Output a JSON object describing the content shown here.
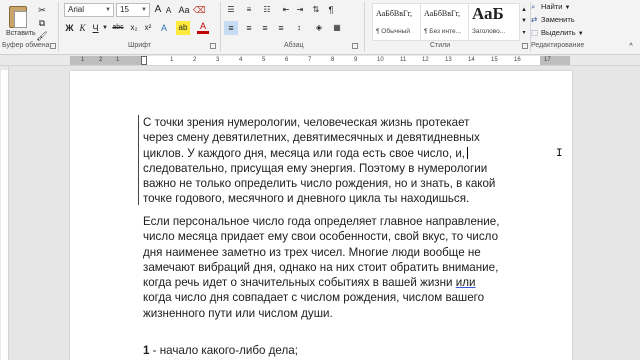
{
  "ribbon": {
    "clipboard": {
      "paste_label": "Вставить",
      "group_label": "Буфер обмена"
    },
    "font": {
      "font_name": "Arial",
      "font_size": "15",
      "grow_label": "A",
      "shrink_label": "A",
      "case_label": "Aa",
      "bold_label": "Ж",
      "italic_label": "К",
      "underline_label": "Ч",
      "strike_label": "abc",
      "subscript_label": "x₂",
      "superscript_label": "x²",
      "effects_label": "A",
      "highlight_label": "ab",
      "color_label": "A",
      "group_label": "Шрифт"
    },
    "paragraph": {
      "group_label": "Абзац"
    },
    "styles": {
      "items": [
        {
          "sample": "АаБбВвГг,",
          "name": "¶ Обычный"
        },
        {
          "sample": "АаБбВвГг,",
          "name": "¶ Без инте..."
        },
        {
          "sample": "АаБ",
          "name": "Заголово..."
        }
      ],
      "group_label": "Стили"
    },
    "editing": {
      "find_label": "Найти",
      "replace_label": "Заменить",
      "select_label": "Выделить",
      "group_label": "Редактирование"
    }
  },
  "ruler": {
    "numbers": [
      "1",
      "2",
      "1",
      "1",
      "2",
      "3",
      "4",
      "5",
      "6",
      "7",
      "8",
      "9",
      "10",
      "11",
      "12",
      "13",
      "14",
      "15",
      "16",
      "17"
    ]
  },
  "document": {
    "paragraph1": [
      " С точки зрения нумерологии, человеческая жизнь протекает",
      "через смену девятилетних, девятимесячных и девятидневных",
      "циклов. У каждого дня, месяца или года есть свое число, и,",
      "следовательно, присущая ему энергия. Поэтому в нумерологии",
      "важно не только определить число рождения, но и знать, в какой",
      "точке годового, месячного и дневного цикла ты находишься."
    ],
    "paragraph2": [
      "Если персональное число года определяет главное направление,",
      "число месяца придает ему свои особенности, свой вкус, то число",
      "дня наименее заметно из трех чисел. Многие люди вообще не",
      "замечают вибраций дня, однако на них стоит обратить внимание,",
      "когда речь идет о значительных событиях в вашей жизни ",
      "когда число дня совпадает с числом рождения, числом вашего",
      "жизненного пути или числом души."
    ],
    "misspelled_word": "или",
    "list_item_number": "1",
    "list_item_text": " - начало какого-либо дела;"
  }
}
